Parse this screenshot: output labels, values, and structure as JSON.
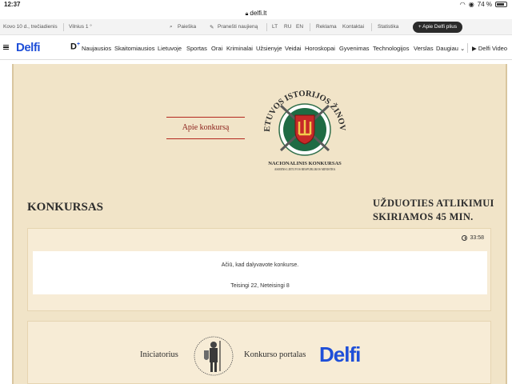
{
  "status_bar": {
    "time": "12:37",
    "battery": "74 %"
  },
  "browser": {
    "url": "delfi.lt"
  },
  "utility_bar": {
    "date": "Kovo 10 d., trečiadienis",
    "city": "Vilnius 1 °",
    "search": "Paieška",
    "report": "Pranešti naujieną",
    "lang_lt": "LT",
    "lang_ru": "RU",
    "lang_en": "EN",
    "ads": "Reklama",
    "contacts": "Kontaktai",
    "stats": "Statistika",
    "plus_button": "+ Apie Delfi plius"
  },
  "nav": {
    "logo": "Delfi",
    "dplus": "D",
    "items": [
      "Naujausios",
      "Skaitomiausios",
      "Lietuvoje",
      "Sportas",
      "Orai",
      "Kriminalai",
      "Užsienyje",
      "Veidai",
      "Horoskopai",
      "Gyvenimas",
      "Technologijos",
      "Verslas",
      "Daugiau"
    ],
    "video": "Delfi Video"
  },
  "emblem": {
    "arc_text": "LIETUVOS ISTORIJOS ŽINOVAS",
    "sub1": "NACIONALINIS KONKURSAS",
    "sub2": "ASMENS LIETUVOS RESPUBLIKOS MINISTRA"
  },
  "about_button": "Apie konkursą",
  "quiz": {
    "title": "KONKURSAS",
    "time_note_line1": "UŽDUOTIES ATLIKIMUI",
    "time_note_line2": "SKIRIAMOS 45 MIN.",
    "timer": "33:58",
    "thanks": "Ačiū, kad dalyvavote konkurse.",
    "score": "Teisingi 22, Neteisingi 8"
  },
  "partners": {
    "initiator_label": "Iniciatorius",
    "portal_label": "Konkurso portalas",
    "portal_logo": "Delfi"
  },
  "colors": {
    "brand_blue": "#1f4fd8",
    "accent_red": "#b3261e",
    "parchment": "#f1e4c8"
  }
}
